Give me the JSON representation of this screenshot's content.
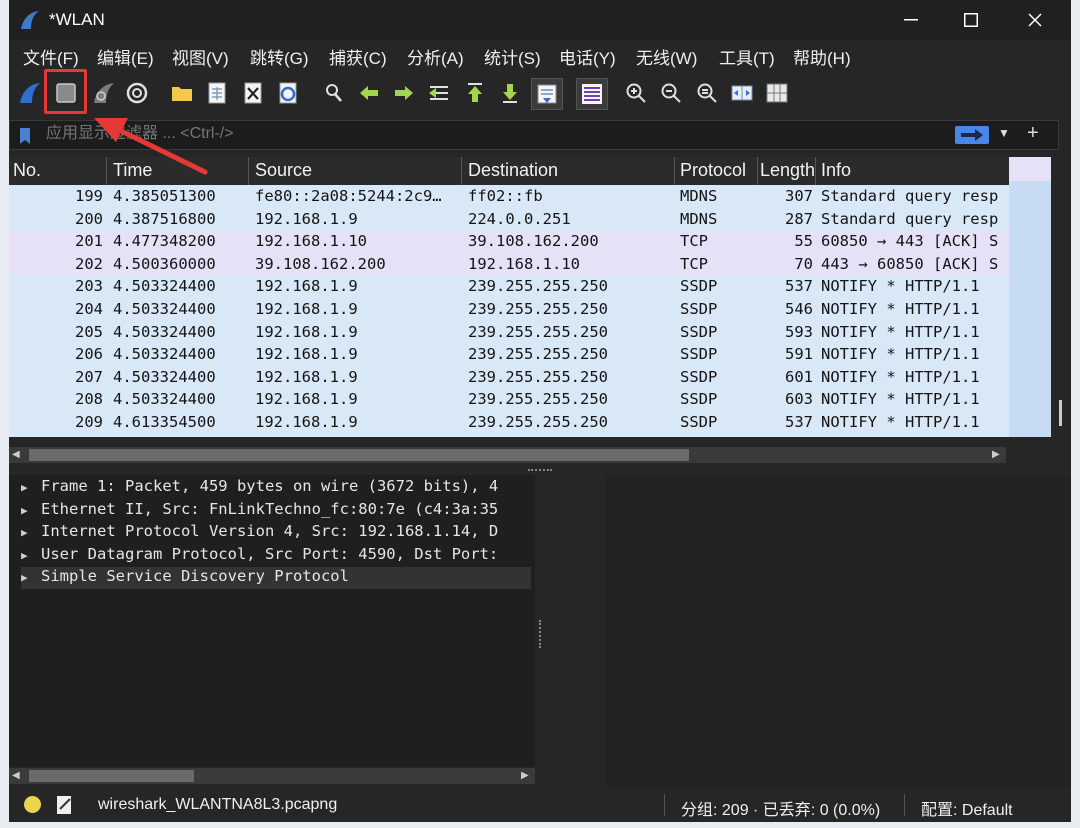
{
  "window": {
    "title": "*WLAN"
  },
  "menu": [
    "文件(F)",
    "编辑(E)",
    "视图(V)",
    "跳转(G)",
    "捕获(C)",
    "分析(A)",
    "统计(S)",
    "电话(Y)",
    "无线(W)",
    "工具(T)",
    "帮助(H)"
  ],
  "filter": {
    "placeholder": "应用显示过滤器 ... <Ctrl-/>"
  },
  "columns": [
    "No.",
    "Time",
    "Source",
    "Destination",
    "Protocol",
    "Length",
    "Info"
  ],
  "packets": [
    {
      "no": "199",
      "time": "4.385051300",
      "src": "fe80::2a08:5244:2c9…",
      "dst": "ff02::fb",
      "proto": "MDNS",
      "len": "307",
      "info": "Standard query resp"
    },
    {
      "no": "200",
      "time": "4.387516800",
      "src": "192.168.1.9",
      "dst": "224.0.0.251",
      "proto": "MDNS",
      "len": "287",
      "info": "Standard query resp"
    },
    {
      "no": "201",
      "time": "4.477348200",
      "src": "192.168.1.10",
      "dst": "39.108.162.200",
      "proto": "TCP",
      "len": "55",
      "info": "60850 → 443 [ACK] S"
    },
    {
      "no": "202",
      "time": "4.500360000",
      "src": "39.108.162.200",
      "dst": "192.168.1.10",
      "proto": "TCP",
      "len": "70",
      "info": "443 → 60850 [ACK] S"
    },
    {
      "no": "203",
      "time": "4.503324400",
      "src": "192.168.1.9",
      "dst": "239.255.255.250",
      "proto": "SSDP",
      "len": "537",
      "info": "NOTIFY * HTTP/1.1"
    },
    {
      "no": "204",
      "time": "4.503324400",
      "src": "192.168.1.9",
      "dst": "239.255.255.250",
      "proto": "SSDP",
      "len": "546",
      "info": "NOTIFY * HTTP/1.1"
    },
    {
      "no": "205",
      "time": "4.503324400",
      "src": "192.168.1.9",
      "dst": "239.255.255.250",
      "proto": "SSDP",
      "len": "593",
      "info": "NOTIFY * HTTP/1.1"
    },
    {
      "no": "206",
      "time": "4.503324400",
      "src": "192.168.1.9",
      "dst": "239.255.255.250",
      "proto": "SSDP",
      "len": "591",
      "info": "NOTIFY * HTTP/1.1"
    },
    {
      "no": "207",
      "time": "4.503324400",
      "src": "192.168.1.9",
      "dst": "239.255.255.250",
      "proto": "SSDP",
      "len": "601",
      "info": "NOTIFY * HTTP/1.1"
    },
    {
      "no": "208",
      "time": "4.503324400",
      "src": "192.168.1.9",
      "dst": "239.255.255.250",
      "proto": "SSDP",
      "len": "603",
      "info": "NOTIFY * HTTP/1.1"
    },
    {
      "no": "209",
      "time": "4.613354500",
      "src": "192.168.1.9",
      "dst": "239.255.255.250",
      "proto": "SSDP",
      "len": "537",
      "info": "NOTIFY * HTTP/1.1"
    }
  ],
  "details": [
    "Frame 1: Packet, 459 bytes on wire (3672 bits), 4",
    "Ethernet II, Src: FnLinkTechno_fc:80:7e (c4:3a:35",
    "Internet Protocol Version 4, Src: 192.168.1.14, D",
    "User Datagram Protocol, Src Port: 4590, Dst Port:",
    "Simple Service Discovery Protocol"
  ],
  "status": {
    "file": "wireshark_WLANTNA8L3.pcapng",
    "packets": "分组: 209 · 已丢弃: 0 (0.0%)",
    "profile": "配置: Default"
  },
  "colors": {
    "udp_row": "#d9e8f7",
    "tcp_row": "#e6e1f7",
    "highlight": "#e53935"
  }
}
